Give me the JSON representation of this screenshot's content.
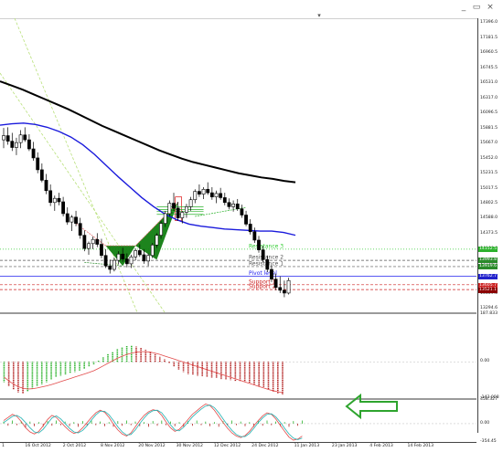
{
  "window": {
    "minimize_icon": "minimize-icon",
    "restore_icon": "restore-icon",
    "close_icon": "close-icon",
    "minimize_glyph": "_",
    "restore_glyph": "▭",
    "close_glyph": "×",
    "dropdown_icon": "dropdown-triangle-icon"
  },
  "arrow": {
    "icon": "left-arrow-icon",
    "color": "#2ea42e"
  },
  "chart_data": [
    {
      "type": "candlestick",
      "title": "",
      "y_ticks": [
        "17396.0",
        "17181.5",
        "16960.5",
        "16745.5",
        "16531.0",
        "16317.0",
        "16096.5",
        "15881.5",
        "15667.0",
        "15452.0",
        "15231.5",
        "15017.5",
        "14802.5",
        "14588.0",
        "14373.5",
        "14152.5",
        "13938.5",
        "13723.5",
        "13509.0",
        "13294.6"
      ],
      "ylim": [
        13244,
        17465
      ],
      "x_ticks": [
        "1",
        "16 Oct 2012",
        "2 Oct 2012",
        "8 Nov 2012",
        "20 Nov 2012",
        "30 Nov 2012",
        "12 Dec 2012",
        "24 Dec 2012",
        "11 Jan 2013",
        "23 Jan 2013",
        "4 Feb 2013",
        "14 Feb 2013"
      ],
      "x_tick_index": [
        0,
        6,
        14,
        22,
        30,
        38,
        46,
        54,
        63,
        71,
        79,
        87
      ],
      "candles": [
        [
          15720,
          15890,
          15600,
          15780
        ],
        [
          15780,
          15900,
          15650,
          15700
        ],
        [
          15700,
          15820,
          15560,
          15610
        ],
        [
          15610,
          15750,
          15500,
          15680
        ],
        [
          15680,
          15860,
          15600,
          15790
        ],
        [
          15790,
          15900,
          15690,
          15720
        ],
        [
          15720,
          15800,
          15560,
          15590
        ],
        [
          15590,
          15690,
          15420,
          15460
        ],
        [
          15460,
          15540,
          15240,
          15290
        ],
        [
          15290,
          15380,
          15110,
          15140
        ],
        [
          15140,
          15230,
          14940,
          14990
        ],
        [
          14990,
          15080,
          14770,
          14820
        ],
        [
          14820,
          14920,
          14700,
          14880
        ],
        [
          14880,
          14960,
          14780,
          14830
        ],
        [
          14830,
          14900,
          14620,
          14660
        ],
        [
          14660,
          14750,
          14500,
          14540
        ],
        [
          14540,
          14640,
          14410,
          14610
        ],
        [
          14610,
          14700,
          14480,
          14520
        ],
        [
          14520,
          14600,
          14300,
          14350
        ],
        [
          14350,
          14420,
          14120,
          14160
        ],
        [
          14160,
          14260,
          14070,
          14230
        ],
        [
          14230,
          14330,
          14150,
          14290
        ],
        [
          14290,
          14380,
          14180,
          14220
        ],
        [
          14220,
          14300,
          14020,
          14060
        ],
        [
          14060,
          14150,
          13880,
          13910
        ],
        [
          13910,
          14000,
          13800,
          13860
        ],
        [
          13860,
          14030,
          13830,
          13990
        ],
        [
          13990,
          14120,
          13930,
          14080
        ],
        [
          14080,
          14170,
          13970,
          14010
        ],
        [
          14010,
          14090,
          13890,
          13940
        ],
        [
          13940,
          14070,
          13880,
          14040
        ],
        [
          14040,
          14160,
          13990,
          14130
        ],
        [
          14130,
          14220,
          14040,
          14070
        ],
        [
          14070,
          14150,
          13940,
          13980
        ],
        [
          13980,
          14090,
          13910,
          14060
        ],
        [
          14060,
          14240,
          14020,
          14210
        ],
        [
          14210,
          14380,
          14170,
          14350
        ],
        [
          14350,
          14560,
          14300,
          14520
        ],
        [
          14520,
          14700,
          14470,
          14660
        ],
        [
          14660,
          14850,
          14620,
          14810
        ],
        [
          14810,
          14960,
          14700,
          14740
        ],
        [
          14740,
          14830,
          14560,
          14600
        ],
        [
          14600,
          14700,
          14520,
          14680
        ],
        [
          14680,
          14800,
          14600,
          14760
        ],
        [
          14760,
          14900,
          14700,
          14860
        ],
        [
          14860,
          15010,
          14810,
          14980
        ],
        [
          14980,
          15080,
          14900,
          14940
        ],
        [
          14940,
          15040,
          14870,
          15010
        ],
        [
          15010,
          15110,
          14930,
          14960
        ],
        [
          14960,
          15040,
          14860,
          14900
        ],
        [
          14900,
          14990,
          14810,
          14950
        ],
        [
          14950,
          15030,
          14860,
          14890
        ],
        [
          14890,
          14960,
          14780,
          14820
        ],
        [
          14820,
          14880,
          14720,
          14760
        ],
        [
          14760,
          14850,
          14690,
          14800
        ],
        [
          14800,
          14870,
          14700,
          14730
        ],
        [
          14730,
          14790,
          14600,
          14640
        ],
        [
          14640,
          14700,
          14480,
          14510
        ],
        [
          14510,
          14580,
          14360,
          14400
        ],
        [
          14400,
          14460,
          14240,
          14280
        ],
        [
          14280,
          14340,
          14100,
          14140
        ],
        [
          14140,
          14200,
          13960,
          14000
        ],
        [
          14000,
          14060,
          13820,
          13860
        ],
        [
          13860,
          13920,
          13680,
          13720
        ],
        [
          13720,
          13800,
          13560,
          13600
        ],
        [
          13600,
          13760,
          13520,
          13560
        ],
        [
          13560,
          13700,
          13460,
          13520
        ],
        [
          13520,
          13740,
          13500,
          13700
        ]
      ],
      "ma_black": [
        16560,
        16500,
        16440,
        16370,
        16300,
        16230,
        16160,
        16080,
        16000,
        15920,
        15850,
        15780,
        15710,
        15640,
        15570,
        15510,
        15450,
        15400,
        15360,
        15320,
        15280,
        15240,
        15210,
        15180,
        15160,
        15130,
        15110
      ],
      "ma_blue": [
        15930,
        15950,
        15960,
        15940,
        15900,
        15840,
        15760,
        15650,
        15510,
        15350,
        15190,
        15040,
        14890,
        14760,
        14650,
        14570,
        14510,
        14480,
        14460,
        14440,
        14430,
        14420,
        14410,
        14410,
        14390,
        14350
      ],
      "levels": [
        {
          "name": "Resistance 3",
          "value": 14150,
          "color": "#32cd32",
          "style": "dotted"
        },
        {
          "name": "Resistance 2",
          "value": 13990,
          "color": "#555555",
          "style": "dashed"
        },
        {
          "name": "Resistance 1",
          "value": 13900,
          "color": "#555555",
          "style": "dashed"
        },
        {
          "name": "Pivot level",
          "value": 13760,
          "color": "#2222ee",
          "style": "solid"
        },
        {
          "name": "Support 1",
          "value": 13640,
          "color": "#cc2222",
          "style": "dashed"
        },
        {
          "name": "Support 2",
          "value": 13570,
          "color": "#cc2222",
          "style": "dashed"
        }
      ],
      "level_labels": [
        "Resistance 3",
        "Resistance 2",
        "Resistance 1",
        "Pivot level",
        "Support 1",
        "Support 2"
      ],
      "price_tags": [
        {
          "text": "14152.5",
          "color": "#2db22d",
          "value": 14150
        },
        {
          "text": "13993.8",
          "color": "#2a8a2a",
          "value": 13990
        },
        {
          "text": "13919.6",
          "color": "#2a8a2a",
          "value": 13900
        },
        {
          "text": "13762.7",
          "color": "#2222cc",
          "value": 13760
        },
        {
          "text": "13605.7",
          "color": "#cc2222",
          "value": 13620
        },
        {
          "text": "13521.1",
          "color": "#8b0000",
          "value": 13565
        }
      ],
      "series_colors": {
        "candle": "#000000",
        "ma_black": "#000000",
        "ma_blue": "#1a1adc",
        "pattern": "#0a7a0a",
        "pattern_line": "#d11"
      }
    },
    {
      "type": "bar",
      "title": "",
      "y_ticks": [
        "187.833",
        "0.00",
        "-143.008"
      ],
      "ylim": [
        -143.008,
        187.833
      ],
      "values": [
        -80,
        -95,
        -110,
        -120,
        -125,
        -118,
        -105,
        -95,
        -88,
        -80,
        -70,
        -60,
        -55,
        -50,
        -45,
        -40,
        -35,
        -28,
        -20,
        -10,
        5,
        18,
        30,
        40,
        50,
        58,
        62,
        65,
        60,
        55,
        48,
        40,
        30,
        20,
        10,
        -5,
        -20,
        -30,
        -40,
        -48,
        -52,
        -55,
        -58,
        -60,
        -62,
        -65,
        -68,
        -70,
        -72,
        -75,
        -78,
        -80,
        -85,
        -88,
        -95,
        -100,
        -110,
        -118,
        -125,
        -130
      ],
      "signal": [
        -60,
        -75,
        -88,
        -98,
        -104,
        -107,
        -106,
        -103,
        -99,
        -95,
        -90,
        -84,
        -78,
        -72,
        -66,
        -60,
        -54,
        -48,
        -42,
        -35,
        -26,
        -16,
        -6,
        4,
        14,
        22,
        29,
        34,
        38,
        40,
        40,
        38,
        34,
        29,
        23,
        17,
        11,
        5,
        -1,
        -7,
        -13,
        -19,
        -25,
        -31,
        -37,
        -43,
        -49,
        -55,
        -61,
        -67,
        -73,
        -79,
        -85,
        -91,
        -97,
        -103,
        -109,
        -114,
        -118,
        -122
      ],
      "colors": {
        "up": "#2db22d",
        "down": "#b22222",
        "signal": "#e24a4a"
      }
    },
    {
      "type": "line",
      "title": "",
      "y_ticks": [
        "458.327",
        "0.00",
        "-354.45"
      ],
      "ylim": [
        -354.45,
        458.327
      ],
      "series": [
        {
          "values": [
            60,
            120,
            180,
            140,
            40,
            -80,
            -160,
            -200,
            -150,
            -40,
            80,
            160,
            120,
            30,
            -60,
            -140,
            -190,
            -160,
            -80,
            20,
            120,
            210,
            260,
            220,
            120,
            -10,
            -120,
            -200,
            -240,
            -180,
            -60,
            60,
            160,
            230,
            270,
            250,
            160,
            30,
            -80,
            -150,
            -110,
            -20,
            80,
            180,
            250,
            320,
            380,
            350,
            260,
            140,
            20,
            -90,
            -180,
            -240,
            -270,
            -230,
            -150,
            -40,
            60,
            150,
            210,
            180,
            90,
            -30,
            -150,
            -260,
            -320,
            -300,
            -240
          ],
          "color": "#e24a4a"
        },
        {
          "values": [
            20,
            80,
            140,
            160,
            110,
            20,
            -80,
            -160,
            -180,
            -110,
            0,
            110,
            150,
            90,
            0,
            -90,
            -160,
            -180,
            -130,
            -40,
            70,
            170,
            240,
            240,
            170,
            60,
            -60,
            -160,
            -220,
            -210,
            -120,
            0,
            110,
            200,
            250,
            260,
            210,
            100,
            -20,
            -120,
            -140,
            -70,
            30,
            130,
            210,
            280,
            340,
            360,
            310,
            210,
            90,
            -30,
            -130,
            -210,
            -250,
            -250,
            -190,
            -90,
            20,
            110,
            180,
            190,
            130,
            30,
            -90,
            -200,
            -280,
            -310,
            -280
          ],
          "color": "#22b2b2"
        }
      ],
      "bar_values": [
        40,
        -40,
        60,
        -30,
        50,
        -70,
        40,
        -50,
        30,
        -60,
        50,
        -40,
        60,
        -30,
        40,
        -50,
        30,
        -60,
        50,
        -40,
        60,
        -30,
        40,
        -50,
        30,
        -60,
        50,
        -40,
        60,
        -30,
        40,
        -50,
        30,
        -60,
        50,
        -40,
        60,
        -30,
        40,
        -50,
        30,
        -60,
        50,
        -40,
        60,
        -30,
        40,
        -50,
        30,
        -60,
        50,
        -40,
        60,
        -30,
        40,
        -50,
        30,
        -60,
        50,
        -40,
        60,
        -30,
        40,
        -50,
        30,
        -60,
        50,
        -40,
        60
      ],
      "bar_colors": {
        "up": "#2db22d",
        "down": "#b22222"
      }
    }
  ]
}
